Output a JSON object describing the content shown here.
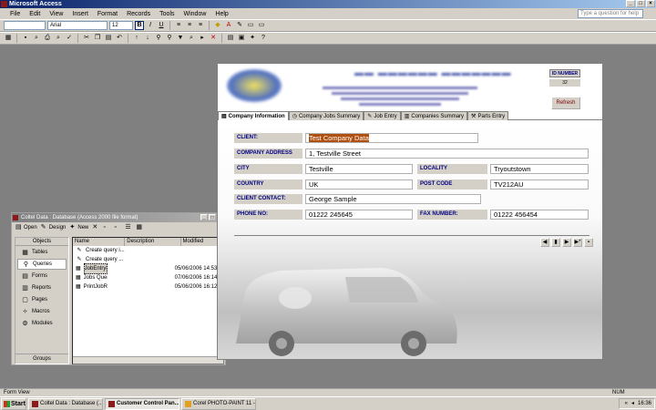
{
  "window": {
    "title": "Microsoft Access"
  },
  "menu": [
    "File",
    "Edit",
    "View",
    "Insert",
    "Format",
    "Records",
    "Tools",
    "Window",
    "Help"
  ],
  "help_placeholder": "Type a question for help",
  "toolbar": {
    "font": "Arial",
    "size": "12",
    "bold": "B",
    "italic": "I",
    "underline": "U"
  },
  "db_window": {
    "title": "Coltel Data : Database (Access 2000 file format)",
    "tools": {
      "open": "Open",
      "design": "Design",
      "new": "New"
    },
    "objects_header": "Objects",
    "objects": [
      "Tables",
      "Queries",
      "Forms",
      "Reports",
      "Pages",
      "Macros",
      "Modules"
    ],
    "groups": "Groups",
    "columns": [
      "Name",
      "Description",
      "Modified"
    ],
    "rows": [
      {
        "name": "Create query i...",
        "modified": ""
      },
      {
        "name": "Create query ...",
        "modified": ""
      },
      {
        "name": "JobEntryPage ...",
        "modified": "05/06/2006 14:53:..."
      },
      {
        "name": "Jobs Query",
        "modified": "07/06/2006 16:14:..."
      },
      {
        "name": "PrintJobRepor...",
        "modified": "05/06/2006 16:12:..."
      }
    ]
  },
  "form": {
    "id_label": "ID NUMBER",
    "id_value": "32",
    "refresh": "Refresh",
    "tabs": [
      "Company Information",
      "Company Jobs Summary",
      "Job Entry",
      "Companies Summary",
      "Parts Entry"
    ],
    "fields": {
      "client_label": "CLIENT:",
      "client": "Test Company Data",
      "address_label": "COMPANY ADDRESS",
      "address": "1, Testville Street",
      "city_label": "CITY",
      "city": "Testville",
      "locality_label": "LOCALITY",
      "locality": "Tryoutstown",
      "country_label": "COUNTRY",
      "country": "UK",
      "postcode_label": "POST CODE",
      "postcode": "TV212AU",
      "contact_label": "CLIENT CONTACT:",
      "contact": "George Sample",
      "phone_label": "PHONE NO:",
      "phone": "01222 245645",
      "fax_label": "FAX NUMBER:",
      "fax": "01222 456454"
    }
  },
  "statusbar": {
    "left": "Form View",
    "right": "NUM"
  },
  "taskbar": {
    "start": "Start",
    "tasks": [
      "Coltel Data : Database (...",
      "Customer Control Pan...",
      "Corel PHOTO-PAINT 11 -..."
    ],
    "time": "16:36"
  }
}
